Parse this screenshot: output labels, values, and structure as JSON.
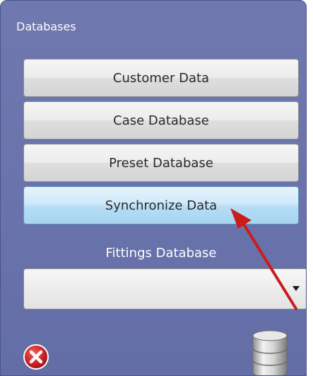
{
  "panel": {
    "title": "Databases"
  },
  "buttons": {
    "customer_data": "Customer Data",
    "case_database": "Case Database",
    "preset_database": "Preset Database",
    "synchronize_data": "Synchronize Data"
  },
  "fittings": {
    "label": "Fittings Database",
    "selected_value": ""
  },
  "icons": {
    "close": "close-icon",
    "database": "database-icon",
    "annotation_arrow": "red-arrow"
  },
  "colors": {
    "panel_bg": "#6a73ab",
    "active_button": "#b5ddf5",
    "close_red": "#d4242a",
    "arrow_red": "#cc1b1b"
  }
}
